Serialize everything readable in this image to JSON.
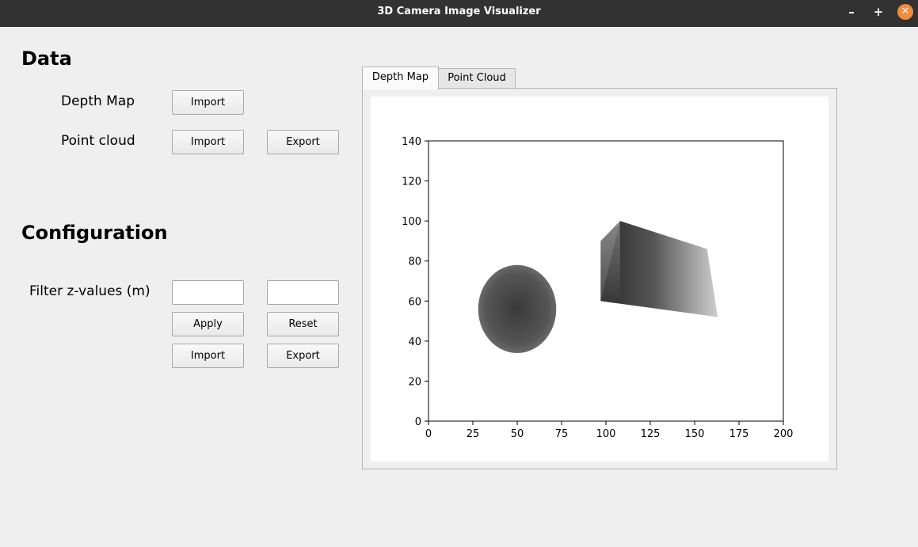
{
  "window": {
    "title": "3D Camera Image Visualizer",
    "minimize_icon": "minus-icon",
    "maximize_icon": "plus-icon",
    "close_icon": "close-icon",
    "close_color": "#f08a3c"
  },
  "data_section": {
    "heading": "Data",
    "depth_map_label": "Depth Map",
    "depth_map_import": "Import",
    "point_cloud_label": "Point cloud",
    "point_cloud_import": "Import",
    "point_cloud_export": "Export"
  },
  "config_section": {
    "heading": "Configuration",
    "filter_label": "Filter z-values (m)",
    "filter_min_value": "",
    "filter_max_value": "",
    "apply": "Apply",
    "reset": "Reset",
    "import": "Import",
    "export": "Export"
  },
  "tabs": [
    {
      "label": "Depth Map",
      "active": true
    },
    {
      "label": "Point Cloud",
      "active": false
    }
  ],
  "chart_data": {
    "type": "heatmap",
    "colormap": "grayscale",
    "xlim": [
      0,
      200
    ],
    "ylim": [
      0,
      140
    ],
    "xticks": [
      0,
      25,
      50,
      75,
      100,
      125,
      150,
      175,
      200
    ],
    "yticks": [
      0,
      20,
      40,
      60,
      80,
      100,
      120,
      140
    ],
    "grid": false,
    "objects": [
      {
        "name": "ellipse",
        "center": [
          50,
          56
        ],
        "radius_x": 22,
        "radius_y": 22,
        "tone": "dark gray"
      },
      {
        "name": "box",
        "corners": [
          [
            97,
            60
          ],
          [
            108,
            100
          ],
          [
            157,
            86
          ],
          [
            163,
            52
          ]
        ],
        "tone": "dark-to-light gray gradient"
      }
    ]
  }
}
